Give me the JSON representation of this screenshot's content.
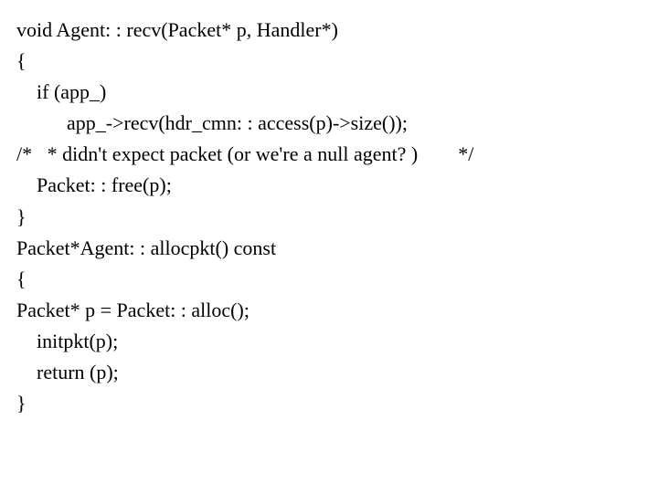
{
  "code": {
    "l1": "void Agent: : recv(Packet* p, Handler*)",
    "l2": "{",
    "l3": "    if (app_)",
    "l4": "          app_->recv(hdr_cmn: : access(p)->size());",
    "l5": "/*   * didn't expect packet (or we're a null agent? )        */",
    "l6": "    Packet: : free(p);",
    "l7": "}",
    "l8": "Packet*Agent: : allocpkt() const",
    "l9": "{",
    "l10": "Packet* p = Packet: : alloc();",
    "l11": "    initpkt(p);",
    "l12": "    return (p);",
    "l13": "}"
  }
}
